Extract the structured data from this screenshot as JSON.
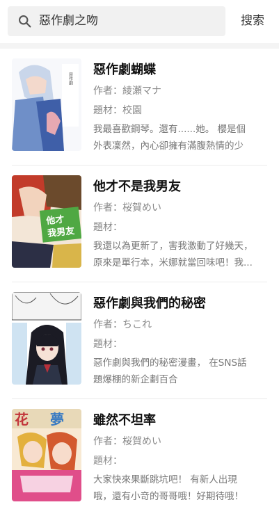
{
  "search": {
    "query": "惡作劇之吻",
    "button_label": "搜索"
  },
  "results": [
    {
      "title": "惡作劇蝴蝶",
      "author": "作者：綾瀬マナ",
      "genre": "題材：校園",
      "description": "我最喜歡鋼琴。還有......她。 櫻是個外表凜然，內心卻擁有滿腹熱情的少女..."
    },
    {
      "title": "他才不是我男友",
      "author": "作者：桜賀めい",
      "genre": "題材：",
      "description": "我還以為更新了，害我激動了好幾天，原來是單行本，米娜就當回味吧！我..."
    },
    {
      "title": "惡作劇與我們的秘密",
      "author": "作者：ちこれ",
      "genre": "題材：",
      "description": "惡作劇與我們的秘密漫畫， 在SNS話題爆棚的新企劃百合"
    },
    {
      "title": "雖然不坦率",
      "author": "作者：桜賀めい",
      "genre": "題材：",
      "description": "大家快來果斷跳坑吧！ 有新人出現哦，還有小竒的哥哥哦！好期待哦！"
    }
  ],
  "colors": {
    "page_bg": "#ffffff",
    "search_bg": "#f1f1f1",
    "title": "#111111",
    "meta": "#888888"
  }
}
